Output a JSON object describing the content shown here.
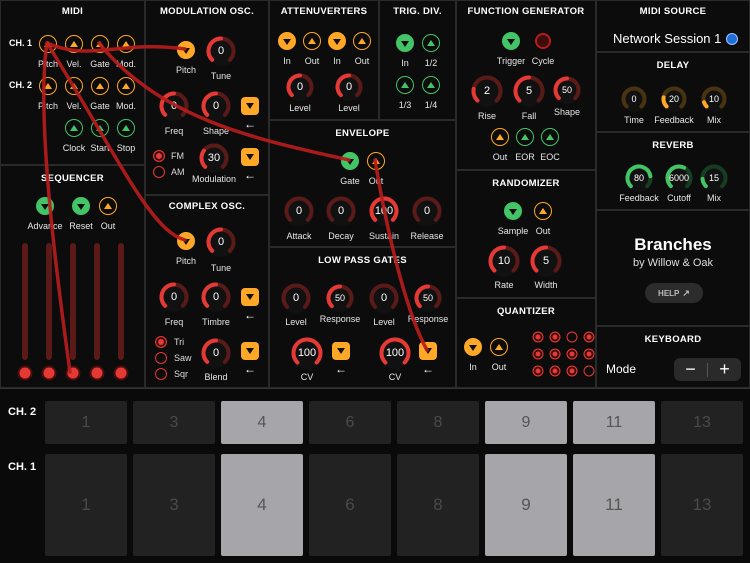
{
  "midi": {
    "title": "MIDI",
    "ch1_label": "CH. 1",
    "ch2_label": "CH. 2",
    "labels": [
      "Pitch",
      "Vel.",
      "Gate",
      "Mod."
    ],
    "clock_labels": [
      "Clock",
      "Start",
      "Stop"
    ]
  },
  "sequencer": {
    "title": "SEQUENCER",
    "labels": [
      "Advance",
      "Reset",
      "Out"
    ]
  },
  "mod_osc": {
    "title": "MODULATION OSC.",
    "pitch": "Pitch",
    "tune": "Tune",
    "tune_value": "0",
    "freq": "Freq",
    "freq_value": "0",
    "shape": "Shape",
    "shape_value": "0",
    "fm": "FM",
    "am": "AM",
    "modulation": "Modulation",
    "modulation_value": "30"
  },
  "complex_osc": {
    "title": "COMPLEX OSC.",
    "pitch": "Pitch",
    "tune": "Tune",
    "tune_value": "0",
    "freq": "Freq",
    "freq_value": "0",
    "timbre": "Timbre",
    "timbre_value": "0",
    "tri": "Tri",
    "saw": "Saw",
    "sqr": "Sqr",
    "blend": "Blend",
    "blend_value": "0"
  },
  "attenuverters": {
    "title": "ATTENUVERTERS",
    "in": "In",
    "out": "Out",
    "level": "Level",
    "level1_value": "0",
    "level2_value": "0"
  },
  "trig_div": {
    "title": "TRIG. DIV.",
    "in": "In",
    "half": "1/2",
    "third": "1/3",
    "quarter": "1/4"
  },
  "envelope": {
    "title": "ENVELOPE",
    "gate": "Gate",
    "out": "Out",
    "attack": "Attack",
    "attack_value": "0",
    "decay": "Decay",
    "decay_value": "0",
    "sustain": "Sustain",
    "sustain_value": "100",
    "release": "Release",
    "release_value": "0"
  },
  "lpg": {
    "title": "LOW PASS GATES",
    "level": "Level",
    "response": "Response",
    "cv": "CV",
    "level1_value": "0",
    "response1_value": "50",
    "level2_value": "0",
    "response2_value": "50",
    "cv1_value": "100",
    "cv2_value": "100"
  },
  "func_gen": {
    "title": "FUNCTION GENERATOR",
    "trigger": "Trigger",
    "cycle": "Cycle",
    "rise": "Rise",
    "rise_value": "2",
    "fall": "Fall",
    "fall_value": "5",
    "shape": "Shape",
    "shape_value": "50",
    "out": "Out",
    "eor": "EOR",
    "eoc": "EOC"
  },
  "randomizer": {
    "title": "RANDOMIZER",
    "sample": "Sample",
    "out": "Out",
    "rate": "Rate",
    "rate_value": "10",
    "width": "Width",
    "width_value": "5"
  },
  "quantizer": {
    "title": "QUANTIZER",
    "in": "In",
    "out": "Out"
  },
  "midi_source": {
    "title": "MIDI SOURCE",
    "value": "Network Session 1"
  },
  "delay": {
    "title": "DELAY",
    "time": "Time",
    "time_value": "0",
    "feedback": "Feedback",
    "feedback_value": "20",
    "mix": "Mix",
    "mix_value": "10"
  },
  "reverb": {
    "title": "REVERB",
    "feedback": "Feedback",
    "feedback_value": "80",
    "cutoff": "Cutoff",
    "cutoff_value": "6000",
    "mix": "Mix",
    "mix_value": "15"
  },
  "branding": {
    "title": "Branches",
    "subtitle": "by Willow & Oak",
    "help": "HELP"
  },
  "keyboard": {
    "title": "KEYBOARD",
    "mode": "Mode",
    "minus": "−",
    "plus": "+"
  },
  "keys": {
    "ch2_label": "CH. 2",
    "ch1_label": "CH. 1",
    "ch2": [
      "1",
      "3",
      "4",
      "6",
      "8",
      "9",
      "11",
      "13"
    ],
    "ch1": [
      "1",
      "3",
      "4",
      "6",
      "8",
      "9",
      "11",
      "13"
    ],
    "ch2_active": [
      false,
      false,
      true,
      false,
      false,
      true,
      true,
      false
    ],
    "ch1_active": [
      false,
      false,
      true,
      false,
      false,
      true,
      true,
      false
    ]
  },
  "colors": {
    "accent": "#ffa726",
    "green": "#43c466",
    "red": "#e53935",
    "dark_red": "#5a1a18",
    "blue": "#1e6fd9"
  }
}
